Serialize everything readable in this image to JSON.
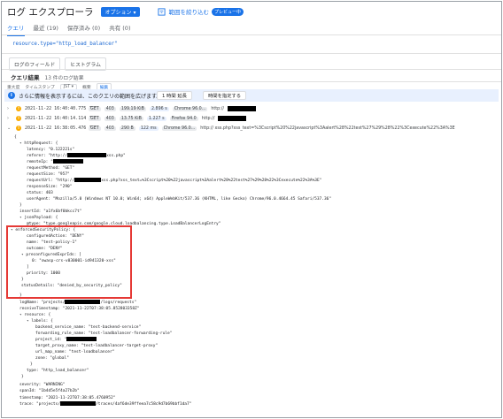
{
  "header": {
    "title": "ログ エクスプローラ",
    "options_label": "オプション ▾",
    "range_link": "範囲を絞り込む",
    "preview_badge": "プレビュー中"
  },
  "tabs": [
    {
      "label": "クエリ"
    },
    {
      "label": "最近 (19)"
    },
    {
      "label": "保存済み (0)"
    },
    {
      "label": "共有 (0)"
    }
  ],
  "query": {
    "text": "resource.type=\"http_load_balancer\""
  },
  "field_bar": {
    "log_fields": "ログのフィールド",
    "histogram": "ヒストグラム"
  },
  "results": {
    "label": "クエリ結果",
    "count": "13 件のログ結果"
  },
  "column_header": {
    "severity": "重大度",
    "timestamp": "タイムスタンプ",
    "tz": "JST ▾",
    "summary": "概要",
    "edit": "編集"
  },
  "info_bar": {
    "text": "さらに情報を表示するには、このクエリの範囲を広げます。",
    "btn_a": "1 時間 延長",
    "btn_b": "時間を指定する"
  },
  "log_rows": [
    {
      "ts": "2021-11-22 16:40:40.775 JST",
      "method": "GET",
      "status": "403",
      "size": "199.19 KiB",
      "latency": "2.896 s",
      "browser": "Chrome 96.0...",
      "url": "http://"
    },
    {
      "ts": "2021-11-22 16:40:14.114 JST",
      "method": "GET",
      "status": "403",
      "size": "13.75 KiB",
      "latency": "1.227 s",
      "browser": "Firefox 94.0",
      "url": "http://"
    },
    {
      "ts": "2021-11-22 16:38:05.476 JST",
      "method": "GET",
      "status": "403",
      "size": "290 B",
      "latency": "122 ms",
      "browser": "Chrome 96.0...",
      "url": "http://                        xss.php?xss_text=%3Cscript%20%22javascript%3Aalert%28%22test%27%29%28%22%3Cexecute%22%3A%3E"
    }
  ],
  "json": {
    "open": "{",
    "httpRequest": "httpRequest: {",
    "latency": "latency: \"0.122221s\"",
    "referer": "referer: \"http://",
    "referer_tail": "xss.php\"",
    "remoteIp": "remoteIp: \"",
    "requestMethod": "requestMethod: \"GET\"",
    "requestSize": "requestSize: \"957\"",
    "requestUrl": "requestUrl: \"http://",
    "requestUrl_tail": "xss.php?xss_text=%3Cscript%20%22javascript%3Aalert%28%22test%27%29%28%22%3Cexecute%22%3A%3E\"",
    "responseSize": "responseSize: \"290\"",
    "status": "status: 403",
    "userAgent": "userAgent: \"Mozilla/5.0 (Windows NT 10.0; Win64; x64) AppleWebKit/537.36 (KHTML, like Gecko) Chrome/96.0.4664.45 Safari/537.36\"",
    "close1": "}",
    "insertId": "insertId: \"a1fx6bf0bkcc7t\"",
    "jsonPayload": "jsonPayload: {",
    "type": "@type: \"type.googleapis.com/google.cloud.loadbalancing.type.LoadBalancerLogEntry\"",
    "enforced": "enforcedSecurityPolicy: {",
    "configuredAction": "configuredAction: \"DENY\"",
    "name": "name: \"test-policy-1\"",
    "outcome": "outcome: \"DENY\"",
    "preconfigured": "preconfiguredExprIds: [",
    "expr0": "0: \"owasp-crs-v030001-id941320-xss\"",
    "close_arr": "]",
    "priority": "priority: 1000",
    "close2": "}",
    "statusDetails": "statusDetails: \"denied_by_security_policy\"",
    "close3": "}",
    "logName": "logName: \"projects/",
    "logName_tail": "/logs/requests\"",
    "receiveTimestamp": "receiveTimestamp: \"2021-11-22T07:38:05.852803358Z\"",
    "resource": "resource: {",
    "labels": "labels: {",
    "backend": "backend_service_name: \"test-backend-service\"",
    "forwarding": "forwarding_rule_name: \"test-loadbalancer-forwarding-rule\"",
    "project_id": "project_id: \"",
    "target_proxy": "target_proxy_name: \"test-loadbalancer-target-proxy\"",
    "url_map": "url_map_name: \"test-loadbalancer\"",
    "zone": "zone: \"global\"",
    "close4": "}",
    "rtype": "type: \"http_load_balancer\"",
    "close5": "}",
    "severity": "severity: \"WARNING\"",
    "spanId": "spanId: \"1b4d5e5f4a27b2b\"",
    "timestamp": "timestamp: \"2021-11-22T07:38:05.4760952\"",
    "trace": "trace: \"projects/",
    "trace_tail": "/traces/4af6de39ffeea7c58c9d7b69bbf1da7\""
  }
}
